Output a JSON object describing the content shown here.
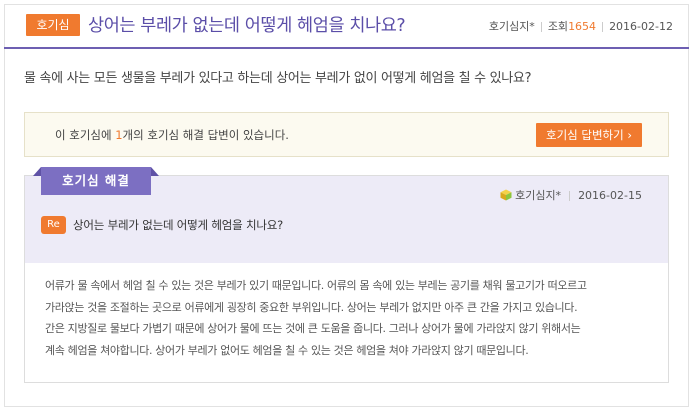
{
  "question": {
    "category": "호기심",
    "title": "상어는 부레가 없는데 어떻게 헤엄을 치나요?",
    "author": "호기심지*",
    "views_label": "조회",
    "views": "1654",
    "date": "2016-02-12",
    "body": "물 속에 사는 모든 생물을 부레가 있다고 하는데 상어는 부레가 없이 어떻게 헤엄을 칠 수 있나요?"
  },
  "notice": {
    "prefix": "이 호기심에 ",
    "count": "1",
    "suffix": "개의 호기심 해결 답변이 있습니다.",
    "button_label": "호기심 답변하기 ›"
  },
  "answer": {
    "tab_label": "호기심 해결",
    "author": "호기심지*",
    "date": "2016-02-15",
    "re_label": "Re",
    "re_title": "상어는 부레가 없는데 어떻게 헤엄을 치나요?",
    "body_lines": [
      "어류가 물 속에서 헤엄 칠 수 있는 것은 부레가 있기 때문입니다. 어류의 몸 속에 있는 부레는 공기를 채워 물고기가 떠오르고",
      "가라앉는 것을 조절하는 곳으로 어류에게 굉장히 중요한 부위입니다. 상어는 부레가 없지만 아주 큰 간을 가지고 있습니다.",
      "간은 지방질로 물보다 가볍기 때문에 상어가 물에 뜨는 것에 큰 도움을 줍니다. 그러나 상어가 물에 가라앉지 않기 위해서는",
      "계속 헤엄을 쳐야합니다. 상어가 부레가 없어도 헤엄을 칠 수 있는 것은 헤엄을 쳐야 가라앉지 않기 때문입니다."
    ]
  },
  "colors": {
    "accent_purple": "#6d5fb2",
    "accent_orange": "#f07a2f"
  },
  "icons": {
    "author_icon": "cube-user-icon"
  }
}
